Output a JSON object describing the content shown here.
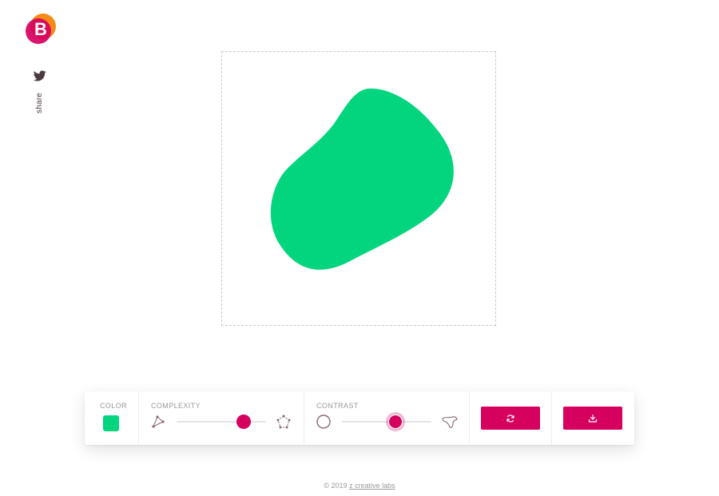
{
  "brand": {
    "logo_letter": "B",
    "logo_colors": [
      "#f48b16",
      "#d6005f"
    ]
  },
  "sidebar": {
    "twitter_icon": "twitter-icon",
    "share_label": "share"
  },
  "canvas": {
    "blob_color": "#02d57d"
  },
  "toolbar": {
    "color": {
      "label": "COLOR",
      "value": "#02d57d"
    },
    "complexity": {
      "label": "COMPLEXITY",
      "min_icon": "triangle-icon",
      "max_icon": "pentagon-icon",
      "value": 0.75
    },
    "contrast": {
      "label": "CONTRAST",
      "min_icon": "circle-icon",
      "max_icon": "spiky-blob-icon",
      "value": 0.6
    },
    "randomize_icon": "refresh-icon",
    "download_icon": "download-icon"
  },
  "footer": {
    "copyright": "© 2019 ",
    "link_text": "z creative labs"
  },
  "colors": {
    "accent": "#d6005f",
    "track": "#e4e4e4",
    "icon_stroke": "#8a6a75"
  }
}
